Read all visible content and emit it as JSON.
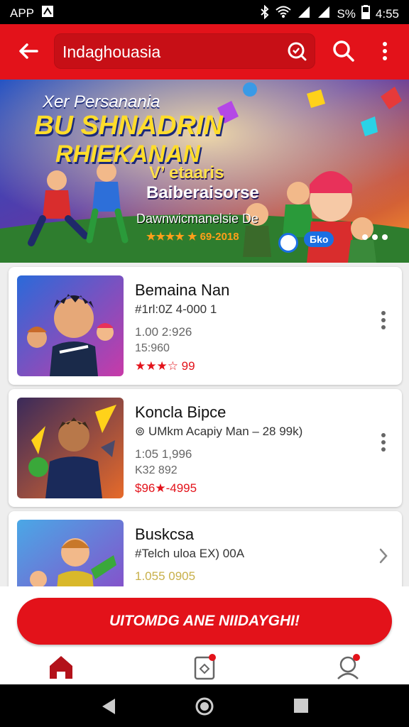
{
  "status_bar": {
    "app_label": "APP",
    "battery": "S%",
    "time": "4:55"
  },
  "toolbar": {
    "search_value": "Indaghouasia"
  },
  "banner": {
    "line1": "Xer Persanania",
    "line2": "BU SHNADRIN",
    "line3": "RHIEKANAN",
    "line4": "V’ etaaris",
    "line5": "Baiberaisorse",
    "line6": "Dawnwicmanelsie De",
    "rating_text": "★★★★ ★ 69-2018",
    "badge_text": "Бko"
  },
  "items": [
    {
      "title": "Bemaina Nan",
      "sub": "#1rl:0Z 4-000 1",
      "line2": "1.00 2:926",
      "line3": "15:960",
      "rating": "★★★☆ 99"
    },
    {
      "title": "Koncla Bipce",
      "sub": "⊚ UMkm Acapiy Man – 28 99k)",
      "line2": "1:05 1,996",
      "line3": "K32 892",
      "rating": "$96★-4995"
    },
    {
      "title": "Buskcsa",
      "sub": "#Telch uloa EX) 00A",
      "line2": "1.055 0905"
    }
  ],
  "cta": {
    "label": "UITOMDG ANE NIIDAYGHI!"
  },
  "colors": {
    "primary": "#e3121a",
    "primary_dark": "#c70f16",
    "star": "#e3121a"
  },
  "icons": {
    "back": "arrow-left-icon",
    "search_inner": "search-badge-icon",
    "search": "search-icon",
    "overflow": "overflow-menu-icon",
    "home": "home-icon",
    "ticket": "ticket-icon",
    "profile": "profile-icon"
  }
}
